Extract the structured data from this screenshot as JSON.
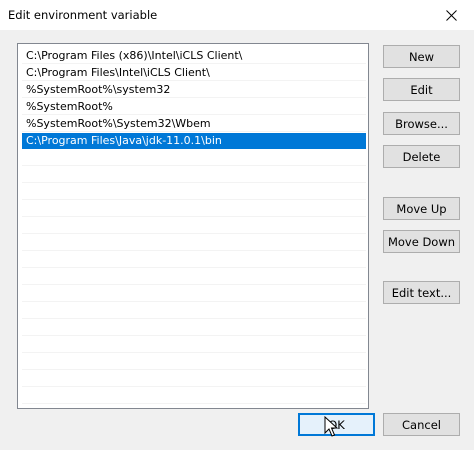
{
  "window": {
    "title": "Edit environment variable"
  },
  "list": {
    "items": [
      {
        "label": "C:\\Program Files (x86)\\Intel\\iCLS Client\\",
        "selected": false
      },
      {
        "label": "C:\\Program Files\\Intel\\iCLS Client\\",
        "selected": false
      },
      {
        "label": "%SystemRoot%\\system32",
        "selected": false
      },
      {
        "label": "%SystemRoot%",
        "selected": false
      },
      {
        "label": "%SystemRoot%\\System32\\Wbem",
        "selected": false
      },
      {
        "label": "C:\\Program Files\\Java\\jdk-11.0.1\\bin",
        "selected": true
      }
    ]
  },
  "buttons": {
    "new": "New",
    "edit": "Edit",
    "browse": "Browse...",
    "delete": "Delete",
    "move_up": "Move Up",
    "move_down": "Move Down",
    "edit_text": "Edit text...",
    "ok": "OK",
    "cancel": "Cancel"
  },
  "colors": {
    "selection": "#0078d7",
    "dialog_background": "#f0f0f0"
  },
  "icons": {
    "close": "close-icon",
    "cursor": "mouse-pointer-icon"
  }
}
